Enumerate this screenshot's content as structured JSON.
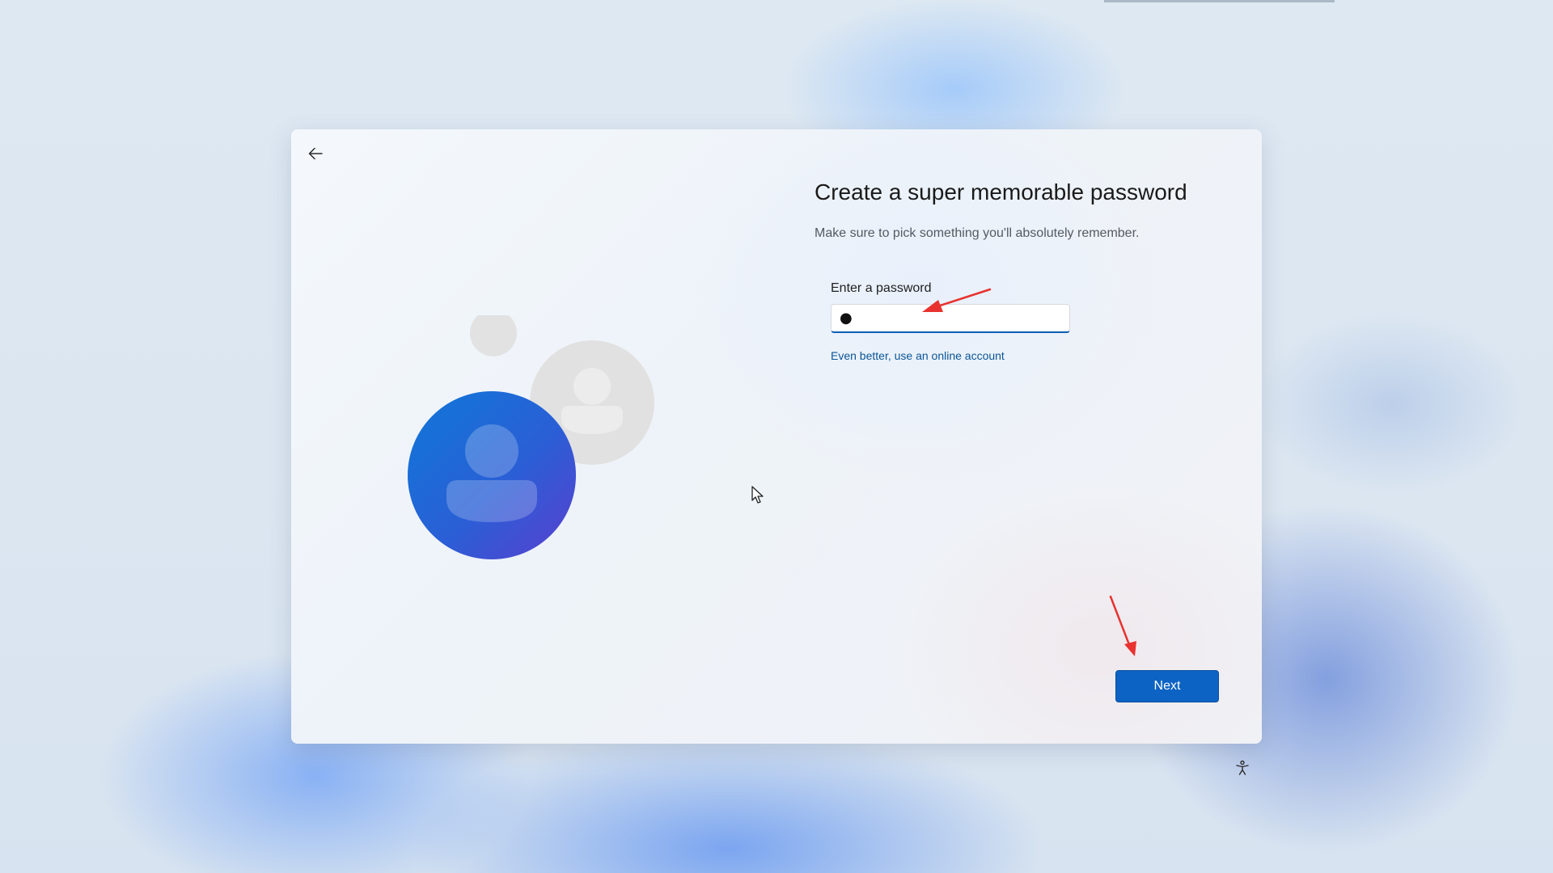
{
  "setup": {
    "title": "Create a super memorable password",
    "subtitle": "Make sure to pick something you'll absolutely remember.",
    "password_field": {
      "label": "Enter a password",
      "value": "●"
    },
    "online_account_link": "Even better, use an online account",
    "next_label": "Next"
  },
  "icons": {
    "back": "arrow-left-icon",
    "accessibility": "accessibility-icon",
    "illustration": "user-accounts-illustration"
  },
  "colors": {
    "accent": "#0d63c3",
    "link": "#0a5596",
    "annotation_arrow": "#e8322f"
  }
}
